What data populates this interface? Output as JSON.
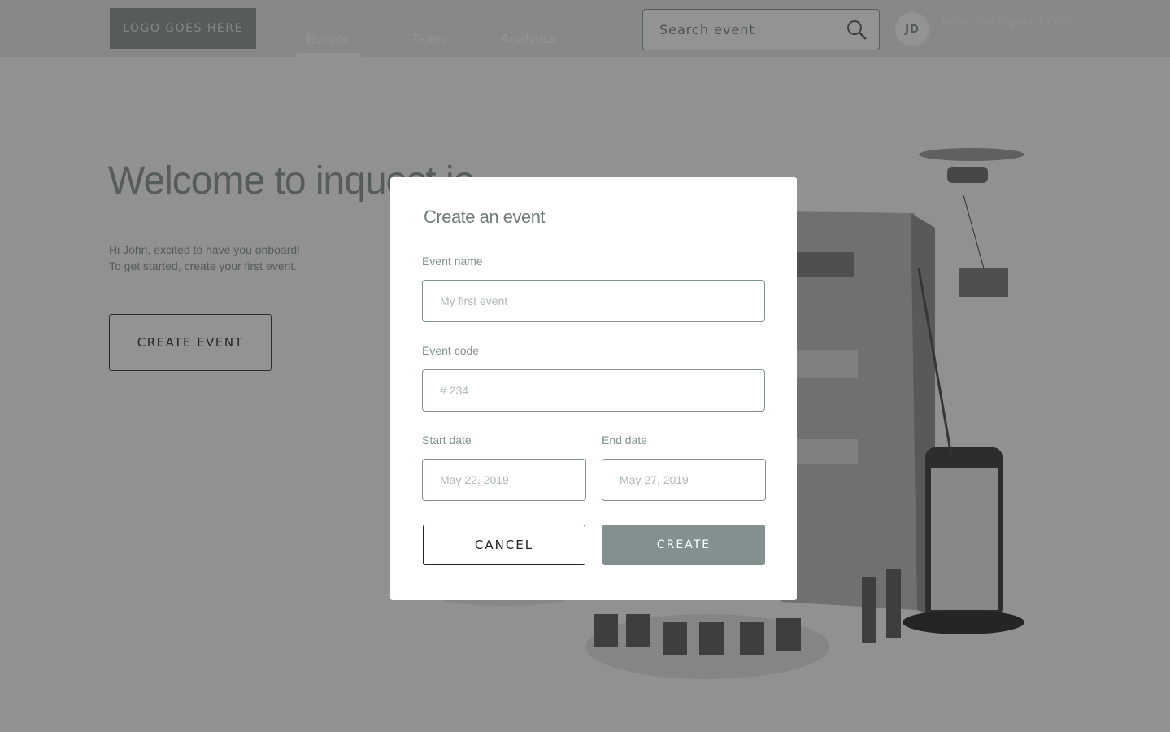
{
  "header": {
    "logo": "LOGO GOES HERE",
    "nav": [
      {
        "label": "Events",
        "active": true
      },
      {
        "label": "Team"
      },
      {
        "label": "Analytics"
      }
    ],
    "search": {
      "placeholder": "Search event",
      "icon": "search-icon"
    },
    "user": {
      "initials": "JD",
      "email": "john.doe@gmail.com",
      "role": "Administrator"
    }
  },
  "main": {
    "title": "Welcome to inquest.io",
    "intro_line1": "Hi John, excited to have you onboard!",
    "intro_line2": "To get started, create your first event.",
    "create_button": "CREATE EVENT"
  },
  "modal": {
    "title": "Create an event",
    "event_name_label": "Event name",
    "event_name_placeholder": "My first event",
    "event_code_label": "Event code",
    "event_code_placeholder": "# 234",
    "start_date_label": "Start date",
    "start_date_placeholder": "May 22, 2019",
    "end_date_label": "End date",
    "end_date_placeholder": "May 27, 2019",
    "cancel": "CANCEL",
    "create": "CREATE"
  },
  "colors": {
    "accent": "#82908f",
    "overlay": "rgba(40,40,40,0.5)"
  }
}
